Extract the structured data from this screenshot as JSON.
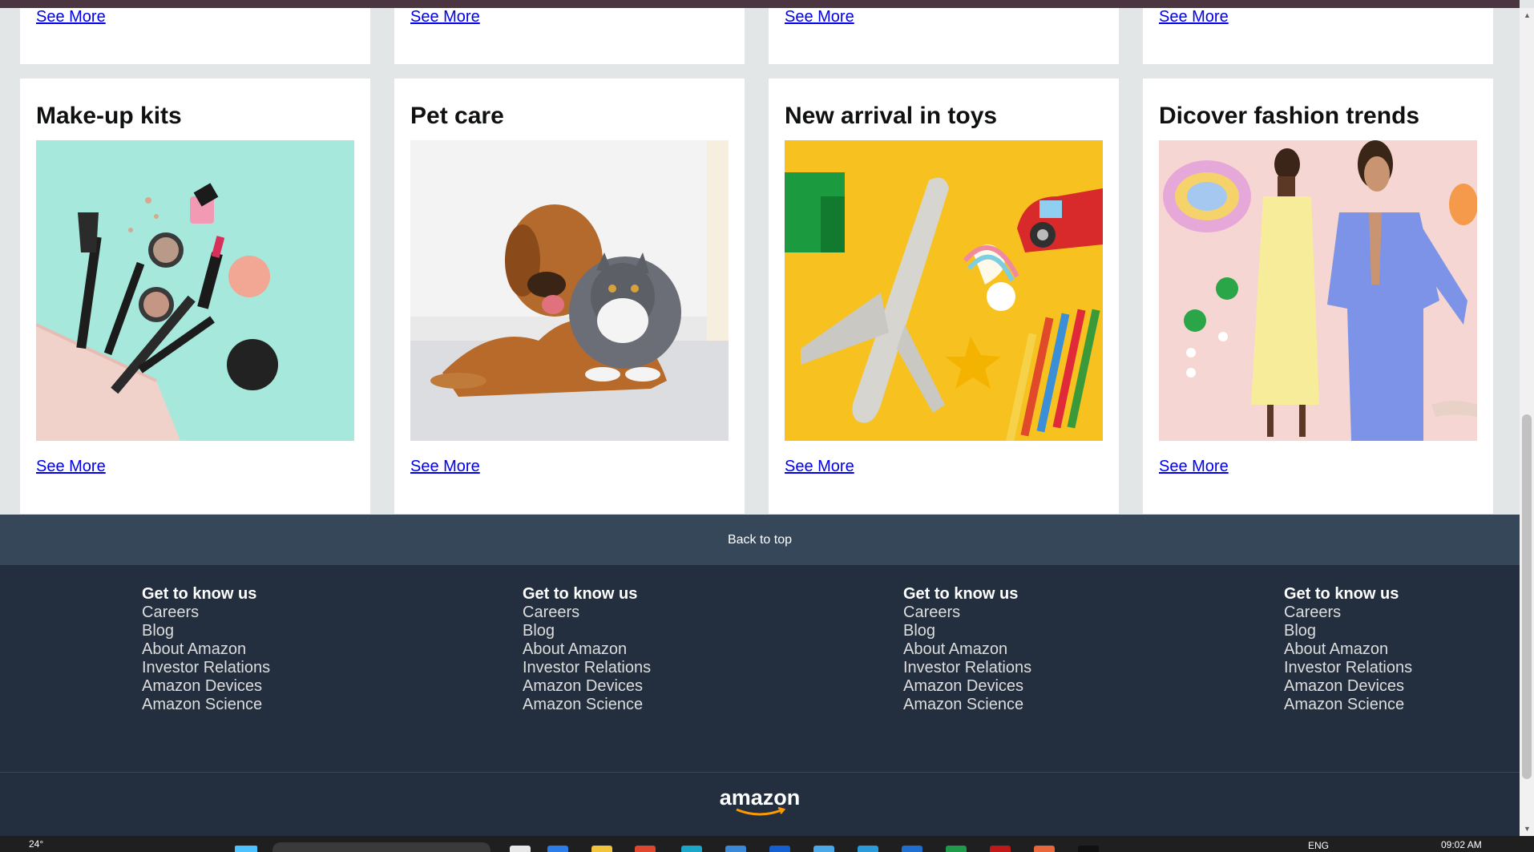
{
  "cards_top_row": [
    {
      "see_more": "See More"
    },
    {
      "see_more": "See More"
    },
    {
      "see_more": "See More"
    },
    {
      "see_more": "See More"
    }
  ],
  "cards": [
    {
      "title": "Make-up kits",
      "see_more": "See More"
    },
    {
      "title": "Pet care",
      "see_more": "See More"
    },
    {
      "title": "New arrival in toys",
      "see_more": "See More"
    },
    {
      "title": "Dicover fashion trends",
      "see_more": "See More"
    }
  ],
  "back_to_top": "Back to top",
  "footer_columns": [
    {
      "heading": "Get to know us",
      "links": [
        "Careers",
        "Blog",
        "About Amazon",
        "Investor Relations",
        "Amazon Devices",
        "Amazon Science"
      ]
    },
    {
      "heading": "Get to know us",
      "links": [
        "Careers",
        "Blog",
        "About Amazon",
        "Investor Relations",
        "Amazon Devices",
        "Amazon Science"
      ]
    },
    {
      "heading": "Get to know us",
      "links": [
        "Careers",
        "Blog",
        "About Amazon",
        "Investor Relations",
        "Amazon Devices",
        "Amazon Science"
      ]
    },
    {
      "heading": "Get to know us",
      "links": [
        "Careers",
        "Blog",
        "About Amazon",
        "Investor Relations",
        "Amazon Devices",
        "Amazon Science"
      ]
    }
  ],
  "logo_text": "amazon",
  "taskbar": {
    "temperature": "24°",
    "language": "ENG",
    "time": "09:02 AM"
  },
  "colors": {
    "page_bg": "#e3e6e6",
    "link": "#0000ee",
    "back_to_top_bg": "#37475a",
    "footer_bg": "#232f3e",
    "logo_arrow": "#ff9900"
  }
}
